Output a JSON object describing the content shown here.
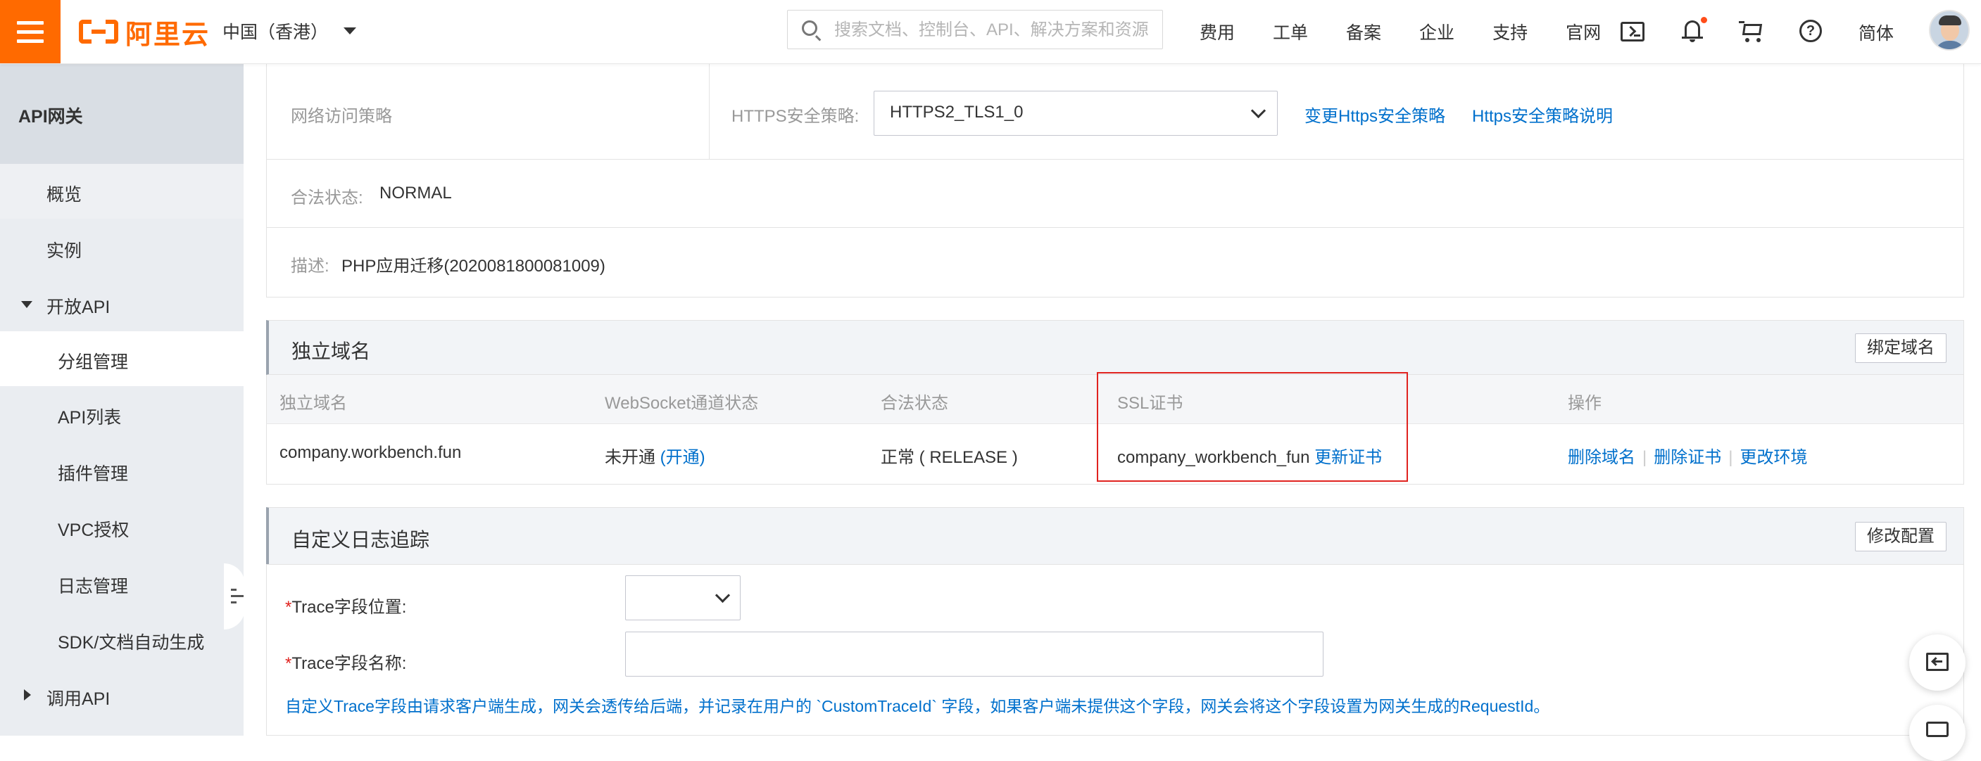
{
  "topbar": {
    "brand": "阿里云",
    "region": "中国（香港）",
    "search_placeholder": "搜索文档、控制台、API、解决方案和资源",
    "nav": [
      "费用",
      "工单",
      "备案",
      "企业",
      "支持",
      "官网"
    ],
    "lang": "简体",
    "icons": [
      "menu-icon",
      "terminal-icon",
      "bell-icon",
      "cart-icon",
      "help-icon"
    ]
  },
  "sidebar": {
    "title": "API网关",
    "items": [
      {
        "label": "概览"
      },
      {
        "label": "实例"
      },
      {
        "label": "开放API"
      },
      {
        "label": "分组管理"
      },
      {
        "label": "API列表"
      },
      {
        "label": "插件管理"
      },
      {
        "label": "VPC授权"
      },
      {
        "label": "日志管理"
      },
      {
        "label": "SDK/文档自动生成"
      },
      {
        "label": "调用API"
      }
    ]
  },
  "basic_info": {
    "network_label": "网络访问策略",
    "https_label": "HTTPS安全策略:",
    "https_value": "HTTPS2_TLS1_0",
    "change_link": "变更Https安全策略",
    "explain_link": "Https安全策略说明",
    "legal_label": "合法状态:",
    "legal_value": "NORMAL",
    "desc_label": "描述:",
    "desc_value": "PHP应用迁移(2020081800081009)"
  },
  "domain_section": {
    "title": "独立域名",
    "bind_button": "绑定域名",
    "columns": [
      "独立域名",
      "WebSocket通道状态",
      "合法状态",
      "SSL证书",
      "操作"
    ],
    "row": {
      "domain": "company.workbench.fun",
      "websocket": "未开通",
      "websocket_link": "(开通)",
      "legal": "正常 ( RELEASE )",
      "ssl": "company_workbench_fun",
      "ssl_link": "更新证书",
      "actions": [
        "删除域名",
        "删除证书",
        "更改环境"
      ]
    }
  },
  "trace_section": {
    "title": "自定义日志追踪",
    "modify_button": "修改配置",
    "position_label": "Trace字段位置:",
    "name_label": "Trace字段名称:",
    "required_mark": "*",
    "hint": "自定义Trace字段由请求客户端生成，网关会透传给后端，并记录在用户的 `CustomTraceId` 字段，如果客户端未提供这个字段，网关会将这个字段设置为网关生成的RequestId。"
  },
  "colors": {
    "brand": "#ff6a00",
    "link": "#0070cc",
    "highlight": "#e0231f",
    "sidebar_bg": "#eaedf1"
  }
}
